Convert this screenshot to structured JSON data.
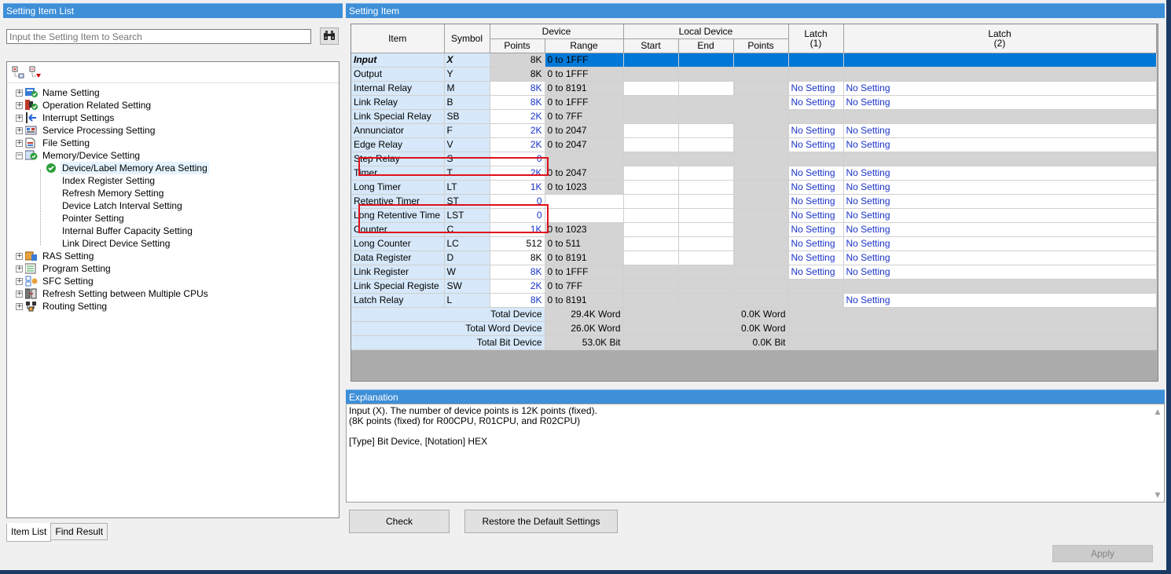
{
  "left_panel": {
    "title": "Setting Item List",
    "search_placeholder": "Input the Setting Item to Search",
    "tree": [
      {
        "label": "Name Setting",
        "icon": "name-setting-icon",
        "expander": "+"
      },
      {
        "label": "Operation Related Setting",
        "icon": "operation-setting-icon",
        "expander": "+"
      },
      {
        "label": "Interrupt Settings",
        "icon": "interrupt-icon",
        "expander": "+"
      },
      {
        "label": "Service Processing Setting",
        "icon": "service-processing-icon",
        "expander": "+"
      },
      {
        "label": "File Setting",
        "icon": "file-setting-icon",
        "expander": "+"
      },
      {
        "label": "Memory/Device Setting",
        "icon": "memory-device-icon",
        "expander": "−"
      },
      {
        "label": "Device/Label Memory Area Setting",
        "icon": "check-icon",
        "child": true,
        "selected": true
      },
      {
        "label": "Index Register Setting",
        "child": true
      },
      {
        "label": "Refresh Memory Setting",
        "child": true
      },
      {
        "label": "Device Latch Interval Setting",
        "child": true
      },
      {
        "label": "Pointer Setting",
        "child": true
      },
      {
        "label": "Internal Buffer Capacity Setting",
        "child": true
      },
      {
        "label": "Link Direct Device Setting",
        "child": true
      },
      {
        "label": "RAS Setting",
        "icon": "ras-setting-icon",
        "expander": "+"
      },
      {
        "label": "Program Setting",
        "icon": "program-setting-icon",
        "expander": "+"
      },
      {
        "label": "SFC Setting",
        "icon": "sfc-setting-icon",
        "expander": "+"
      },
      {
        "label": "Refresh Setting between Multiple CPUs",
        "icon": "multi-cpu-icon",
        "expander": "+"
      },
      {
        "label": "Routing Setting",
        "icon": "routing-setting-icon",
        "expander": "+"
      }
    ],
    "tabs": [
      "Item List",
      "Find Result"
    ]
  },
  "right_panel": {
    "title": "Setting Item",
    "headers": {
      "item": "Item",
      "symbol": "Symbol",
      "device": "Device",
      "points": "Points",
      "range": "Range",
      "local_device": "Local Device",
      "start": "Start",
      "end": "End",
      "local_points": "Points",
      "latch1": "Latch",
      "latch1_sub": "(1)",
      "latch2": "Latch",
      "latch2_sub": "(2)"
    },
    "rows": [
      {
        "item": "Input",
        "symbol": "X",
        "points": "8K",
        "range": "0 to 1FFF",
        "latch1": "",
        "latch2": ""
      },
      {
        "item": "Output",
        "symbol": "Y",
        "points": "8K",
        "range": "0 to 1FFF",
        "latch1": "",
        "latch2": ""
      },
      {
        "item": "Internal Relay",
        "symbol": "M",
        "points": "8K",
        "range": "0 to 8191",
        "latch1": "No Setting",
        "latch2": "No Setting"
      },
      {
        "item": "Link Relay",
        "symbol": "B",
        "points": "8K",
        "range": "0 to 1FFF",
        "latch1": "No Setting",
        "latch2": "No Setting"
      },
      {
        "item": "Link Special Relay",
        "symbol": "SB",
        "points": "2K",
        "range": "0 to 7FF",
        "latch1": "",
        "latch2": ""
      },
      {
        "item": "Annunciator",
        "symbol": "F",
        "points": "2K",
        "range": "0 to 2047",
        "latch1": "No Setting",
        "latch2": "No Setting"
      },
      {
        "item": "Edge Relay",
        "symbol": "V",
        "points": "2K",
        "range": "0 to 2047",
        "latch1": "No Setting",
        "latch2": "No Setting"
      },
      {
        "item": "Step Relay",
        "symbol": "S",
        "points": "0",
        "range": "",
        "latch1": "",
        "latch2": ""
      },
      {
        "item": "Timer",
        "symbol": "T",
        "points": "2K",
        "range": "0 to 2047",
        "latch1": "No Setting",
        "latch2": "No Setting"
      },
      {
        "item": "Long Timer",
        "symbol": "LT",
        "points": "1K",
        "range": "0 to 1023",
        "latch1": "No Setting",
        "latch2": "No Setting"
      },
      {
        "item": "Retentive Timer",
        "symbol": "ST",
        "points": "0",
        "range": "",
        "latch1": "No Setting",
        "latch2": "No Setting"
      },
      {
        "item": "Long Retentive Time",
        "symbol": "LST",
        "points": "0",
        "range": "",
        "latch1": "No Setting",
        "latch2": "No Setting"
      },
      {
        "item": "Counter",
        "symbol": "C",
        "points": "1K",
        "range": "0 to 1023",
        "latch1": "No Setting",
        "latch2": "No Setting"
      },
      {
        "item": "Long Counter",
        "symbol": "LC",
        "points": "512",
        "range": "0 to 511",
        "latch1": "No Setting",
        "latch2": "No Setting"
      },
      {
        "item": "Data Register",
        "symbol": "D",
        "points": "8K",
        "range": "0 to 8191",
        "latch1": "No Setting",
        "latch2": "No Setting"
      },
      {
        "item": "Link Register",
        "symbol": "W",
        "points": "8K",
        "range": "0 to 1FFF",
        "latch1": "No Setting",
        "latch2": "No Setting"
      },
      {
        "item": "Link Special Registe",
        "symbol": "SW",
        "points": "2K",
        "range": "0 to 7FF",
        "latch1": "",
        "latch2": ""
      },
      {
        "item": "Latch Relay",
        "symbol": "L",
        "points": "8K",
        "range": "0 to 8191",
        "latch1": "",
        "latch2": "No Setting"
      }
    ],
    "totals": [
      {
        "label": "Total Device",
        "device": "29.4K Word",
        "local": "0.0K Word"
      },
      {
        "label": "Total Word Device",
        "device": "26.0K Word",
        "local": "0.0K Word"
      },
      {
        "label": "Total Bit Device",
        "device": "53.0K Bit",
        "local": "0.0K Bit"
      }
    ]
  },
  "explanation": {
    "title": "Explanation",
    "line1": "Input (X). The number of device points is 12K points (fixed).",
    "line2": "(8K points (fixed) for R00CPU, R01CPU, and R02CPU)",
    "line3": "[Type] Bit Device, [Notation] HEX"
  },
  "buttons": {
    "check": "Check",
    "restore": "Restore the Default Settings",
    "apply": "Apply"
  },
  "colors": {
    "title_bar": "#3d8fd8",
    "selection": "#0078d7",
    "highlight_box": "#e0101a",
    "link_text": "#1a33c8"
  }
}
